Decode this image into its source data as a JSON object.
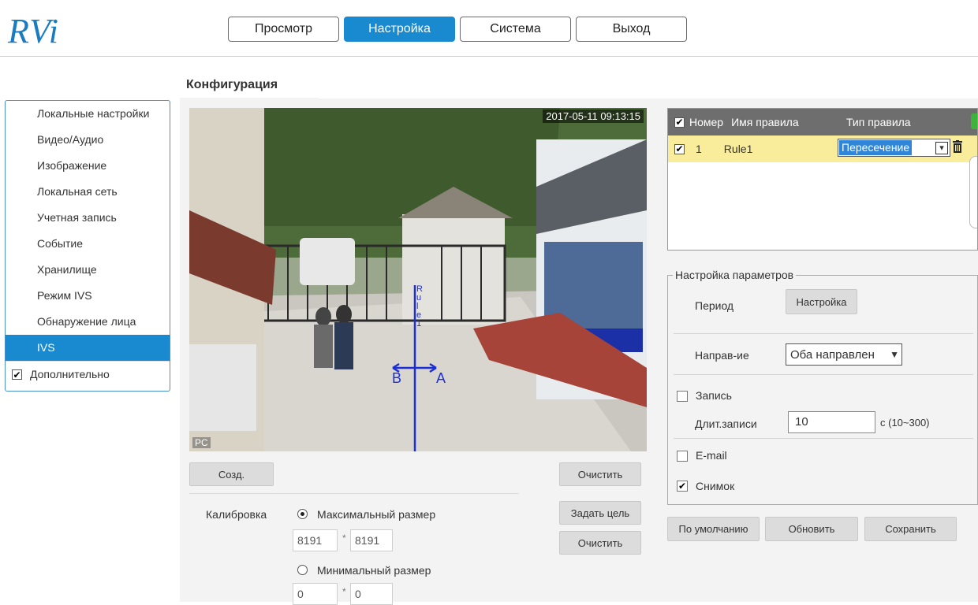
{
  "logo": "RVi",
  "nav": {
    "tabs": [
      "Просмотр",
      "Настройка",
      "Система",
      "Выход"
    ],
    "active": "Настройка"
  },
  "sidebar": {
    "items": [
      "Локальные настройки",
      "Видео/Аудио",
      "Изображение",
      "Локальная сеть",
      "Учетная запись",
      "Событие",
      "Хранилище",
      "Режим IVS",
      "Обнаружение лица",
      "IVS"
    ],
    "active": "IVS",
    "extra": {
      "label": "Дополнительно",
      "checked": true
    }
  },
  "content_tab": "Конфигурация",
  "video": {
    "timestamp": "2017-05-11 09:13:15",
    "osd_corner": "PC",
    "rule_label": "Rule1",
    "dir_left": "B",
    "dir_right": "A"
  },
  "video_buttons": {
    "create": "Созд.",
    "clear": "Очистить",
    "set_target": "Задать цель",
    "clear2": "Очистить"
  },
  "calibration": {
    "label": "Калибровка",
    "max_label": "Максимальный размер",
    "max_w": "8191",
    "max_h": "8191",
    "min_label": "Минимальный размер",
    "min_w": "0",
    "min_h": "0",
    "separator": "*",
    "selected": "max"
  },
  "rules": {
    "columns": [
      "Номер",
      "Имя правила",
      "Тип правила"
    ],
    "rows": [
      {
        "checked": true,
        "number": "1",
        "name": "Rule1",
        "type": "Пересечение"
      }
    ]
  },
  "params": {
    "legend": "Настройка параметров",
    "period_label": "Период",
    "period_button": "Настройка",
    "direction_label": "Направ-ие",
    "direction_value": "Оба направлен",
    "record_label": "Запись",
    "record_checked": false,
    "duration_label": "Длит.записи",
    "duration_value": "10",
    "duration_unit": "с (10~300)",
    "email_label": "E-mail",
    "email_checked": false,
    "snapshot_label": "Снимок",
    "snapshot_checked": true
  },
  "footer_buttons": {
    "default": "По умолчанию",
    "refresh": "Обновить",
    "save": "Сохранить"
  },
  "colors": {
    "accent": "#1a8ad0",
    "rule_row": "#f9ed9c",
    "rule_line": "#1c2fd6",
    "add_icon": "#3cb43c"
  },
  "icons": {
    "checkbox": "✔",
    "dropdown": "chevron-down-icon",
    "delete": "trash-icon",
    "add": "plus-icon"
  }
}
